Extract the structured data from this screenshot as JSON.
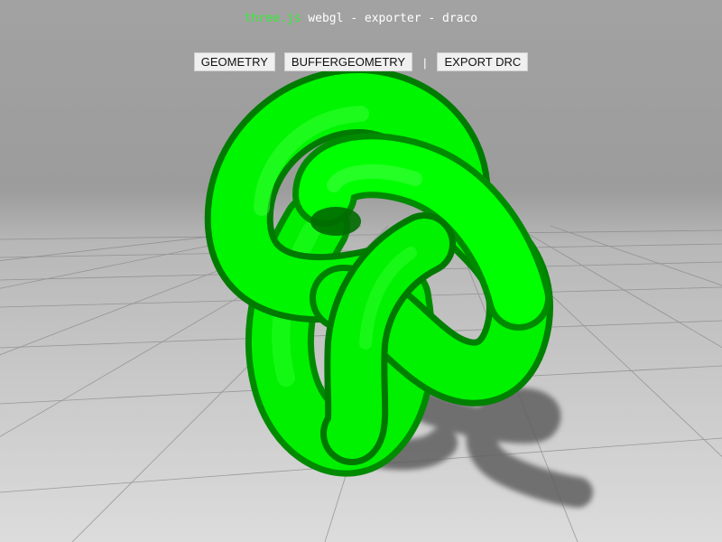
{
  "info": {
    "brand": "three.js",
    "title": " webgl - exporter - draco"
  },
  "toolbar": {
    "geometry_label": "GEOMETRY",
    "buffergeometry_label": "BUFFERGEOMETRY",
    "separator": "|",
    "export_drc_label": "EXPORT DRC"
  },
  "scene": {
    "background_color": "#a0a0a0",
    "floor_color": "#d6d6d6",
    "grid_color": "#8a8a8a",
    "mesh_color": "#00ff00",
    "shadow_color": "#5a5a5a",
    "mesh_shape": "torus-knot"
  }
}
